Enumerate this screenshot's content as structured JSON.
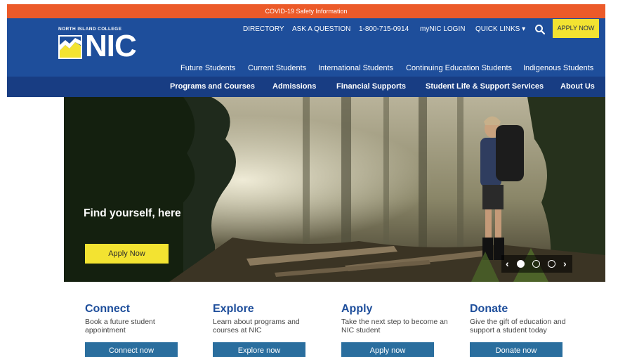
{
  "alert": {
    "text": "COVID-19 Safety Information"
  },
  "brand": {
    "tagline": "NORTH ISLAND COLLEGE",
    "logo_text": "NIC"
  },
  "utility_nav": {
    "directory": "DIRECTORY",
    "ask": "ASK A QUESTION",
    "phone": "1-800-715-0914",
    "mynic": "myNIC LOGIN",
    "quick_links": "QUICK LINKS ▾",
    "apply": "APPLY NOW"
  },
  "audience_nav": [
    "Future Students",
    "Current Students",
    "International Students",
    "Continuing Education Students",
    "Indigenous Students"
  ],
  "main_nav": [
    "Programs and Courses",
    "Admissions",
    "Financial Supports",
    "Student Life & Support Services",
    "About Us"
  ],
  "hero": {
    "title": "Find yourself, here",
    "cta": "Apply Now",
    "carousel": {
      "prev": "‹",
      "next": "›",
      "active_slide": 1,
      "slides": 3
    }
  },
  "cards": [
    {
      "title": "Connect",
      "desc": "Book a future student appointment",
      "button": "Connect now"
    },
    {
      "title": "Explore",
      "desc": "Learn about programs and courses at NIC",
      "button": "Explore now"
    },
    {
      "title": "Apply",
      "desc": "Take the next step to become an NIC student",
      "button": "Apply now"
    },
    {
      "title": "Donate",
      "desc": "Give the gift of education and support a student today",
      "button": "Donate now"
    }
  ],
  "colors": {
    "alert": "#ec5a29",
    "header": "#1e4e9b",
    "main_nav": "#183d83",
    "accent_yellow": "#f3e331",
    "button_blue": "#2a6e9e"
  }
}
